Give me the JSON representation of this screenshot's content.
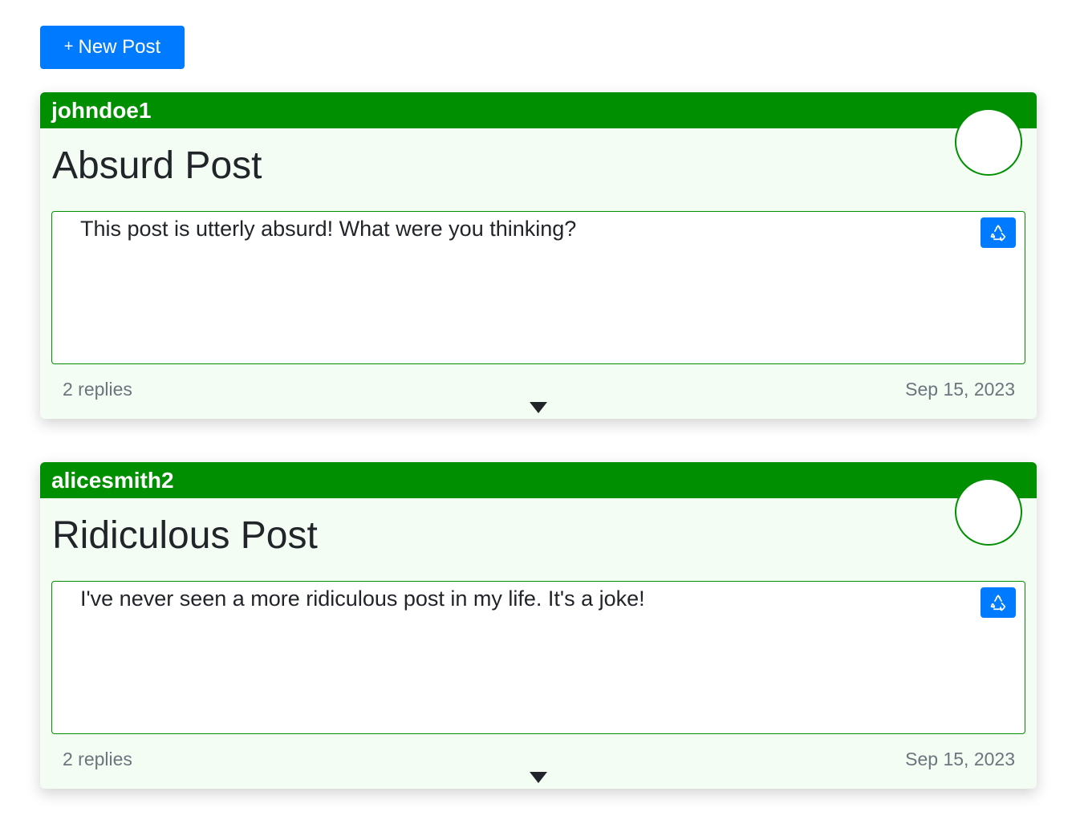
{
  "toolbar": {
    "new_post_plus": "+",
    "new_post_label": "New Post"
  },
  "posts": [
    {
      "username": "johndoe1",
      "title": "Absurd Post",
      "body": "This post is utterly absurd! What were you thinking?",
      "replies": "2 replies",
      "date": "Sep 15, 2023"
    },
    {
      "username": "alicesmith2",
      "title": "Ridiculous Post",
      "body": "I've never seen a more ridiculous post in my life. It's a joke!",
      "replies": "2 replies",
      "date": "Sep 15, 2023"
    }
  ],
  "colors": {
    "primary": "#007bff",
    "header_green": "#008f00",
    "card_bg": "#f3fdf3",
    "muted_text": "#6c757d"
  },
  "icons": {
    "recycle": "recycle-icon",
    "expand": "caret-down-icon",
    "plus": "plus-icon"
  }
}
